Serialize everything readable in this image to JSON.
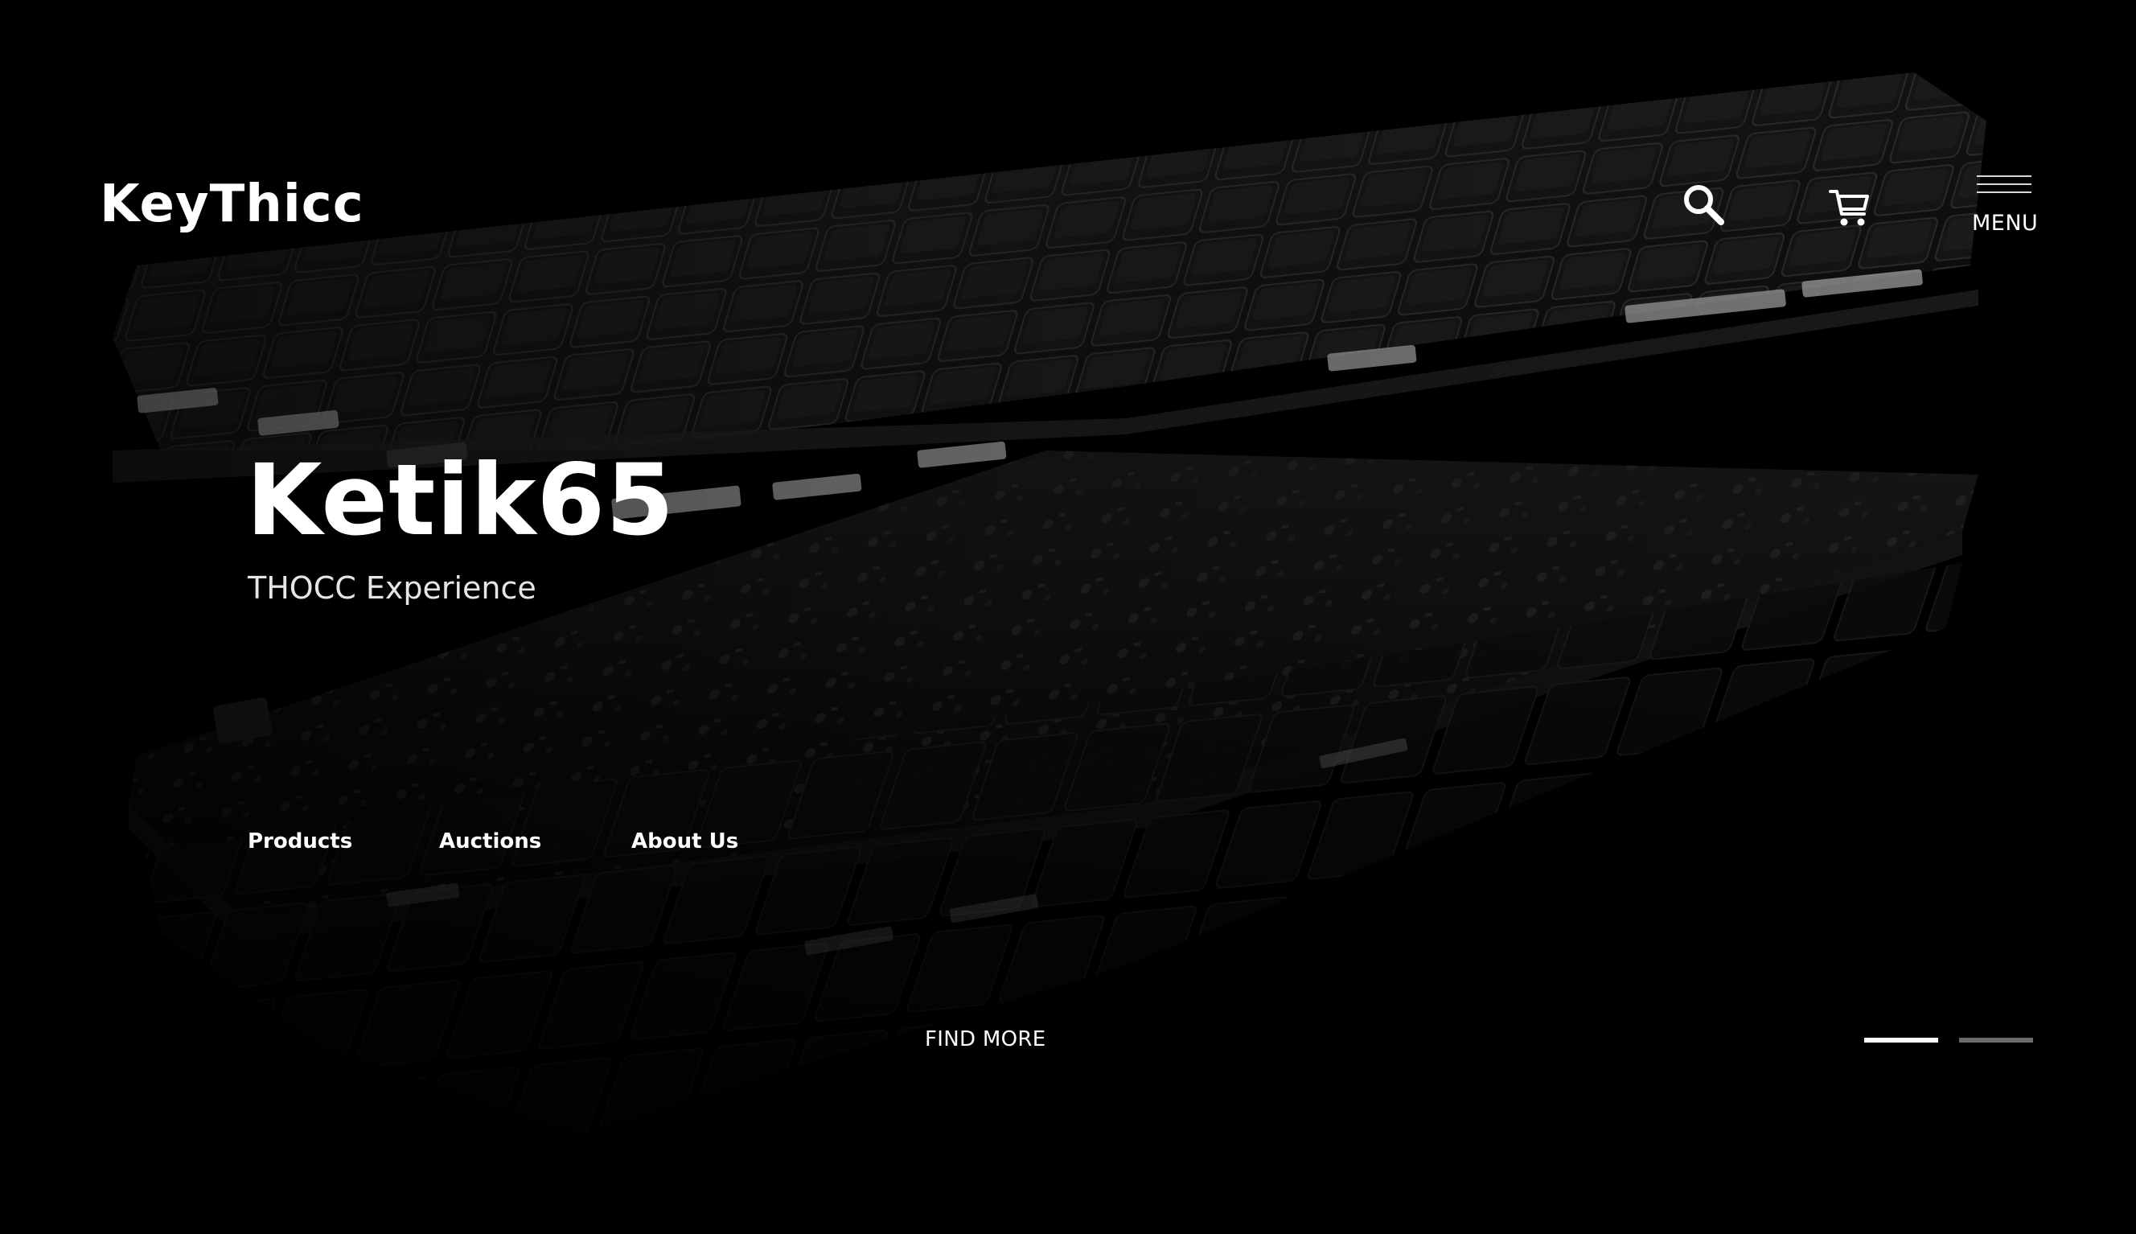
{
  "brand": {
    "name": "KeyThicc"
  },
  "header": {
    "search_icon": "search-icon",
    "cart_icon": "cart-icon",
    "menu_icon": "hamburger-menu-icon",
    "menu_label": "MENU"
  },
  "hero": {
    "title": "Ketik65",
    "subtitle": "THOCC Experience",
    "cta_label": "FIND MORE"
  },
  "nav": {
    "items": [
      {
        "label": "Products"
      },
      {
        "label": "Auctions"
      },
      {
        "label": "About Us"
      }
    ]
  },
  "slider": {
    "total_slides": 2,
    "active_slide": 1,
    "active_color": "#ffffff",
    "inactive_color": "#6b6b6b"
  },
  "colors": {
    "background": "#000000",
    "text": "#ffffff"
  }
}
